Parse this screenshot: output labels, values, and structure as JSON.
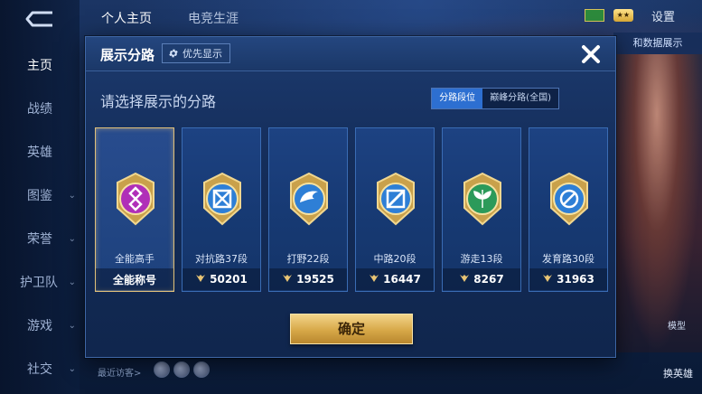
{
  "background": {
    "nav_items": [
      {
        "label": "主页",
        "active": true,
        "chevron": false
      },
      {
        "label": "战绩",
        "active": false,
        "chevron": false
      },
      {
        "label": "英雄",
        "active": false,
        "chevron": false
      },
      {
        "label": "图鉴",
        "active": false,
        "chevron": true
      },
      {
        "label": "荣誉",
        "active": false,
        "chevron": true
      },
      {
        "label": "护卫队",
        "active": false,
        "chevron": true
      },
      {
        "label": "游戏",
        "active": false,
        "chevron": true
      },
      {
        "label": "社交",
        "active": false,
        "chevron": true
      }
    ],
    "top_tabs": [
      "个人主页",
      "电竞生涯"
    ],
    "settings_label": "设置",
    "side_button": "和数据展示",
    "zoom_label": "模型",
    "switch_hero": "换英雄",
    "recent_visitors": "最近访客>"
  },
  "modal": {
    "title": "展示分路",
    "pref_label": "优先显示",
    "subtitle": "请选择展示的分路",
    "tabs": [
      {
        "label": "分路段位",
        "active": true
      },
      {
        "label": "巅峰分路(全国)",
        "active": false
      }
    ],
    "cards": [
      {
        "rank": "全能高手",
        "score": "全能称号",
        "emblem": "allround-emblem-icon",
        "color": "#b02fb8",
        "selected": true,
        "laurel": false
      },
      {
        "rank": "对抗路37段",
        "score": "50201",
        "emblem": "clash-lane-emblem-icon",
        "color": "#2e7fd6",
        "selected": false,
        "laurel": true
      },
      {
        "rank": "打野22段",
        "score": "19525",
        "emblem": "jungle-emblem-icon",
        "color": "#2e7fd6",
        "selected": false,
        "laurel": true
      },
      {
        "rank": "中路20段",
        "score": "16447",
        "emblem": "mid-lane-emblem-icon",
        "color": "#2e7fd6",
        "selected": false,
        "laurel": true
      },
      {
        "rank": "游走13段",
        "score": "8267",
        "emblem": "roam-emblem-icon",
        "color": "#2c9a5a",
        "selected": false,
        "laurel": true
      },
      {
        "rank": "发育路30段",
        "score": "31963",
        "emblem": "farm-lane-emblem-icon",
        "color": "#2e7fd6",
        "selected": false,
        "laurel": true
      }
    ],
    "confirm_label": "确定"
  },
  "colors": {
    "accent_blue": "#2d6fd1",
    "gold": "#d7a848",
    "modal_bg": "#142d5a"
  }
}
